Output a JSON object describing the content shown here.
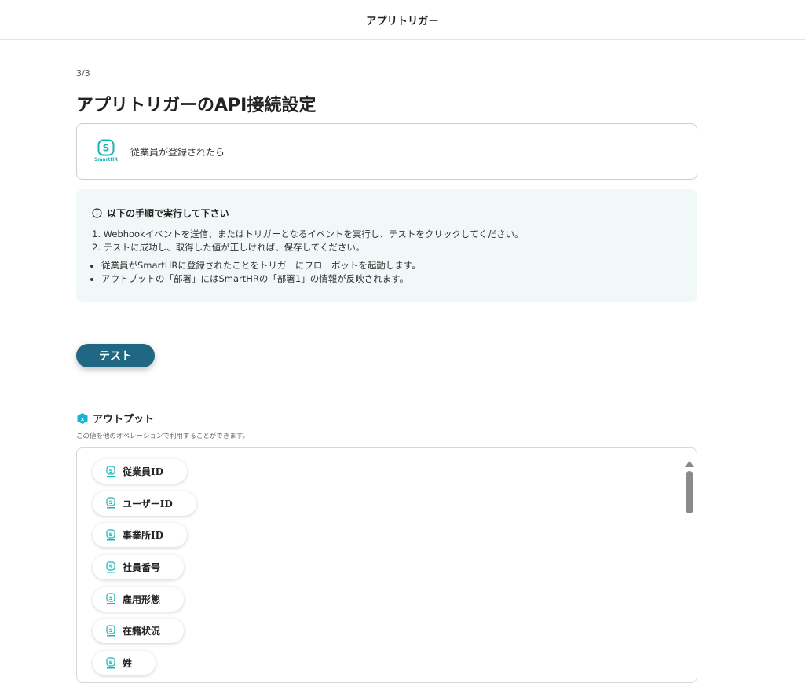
{
  "header": {
    "title": "アプリトリガー"
  },
  "step": "3/3",
  "page_title": "アプリトリガーのAPI接続設定",
  "app_card": {
    "logo_text": "SmartHR",
    "trigger": "従業員が登録されたら"
  },
  "info": {
    "heading": "以下の手順で実行して下さい",
    "steps": [
      "1. Webhookイベントを送信、またはトリガーとなるイベントを実行し、テストをクリックしてください。",
      "2. テストに成功し、取得した値が正しければ、保存してください。"
    ],
    "bullets": [
      "従業員がSmartHRに登録されたことをトリガーにフローボットを起動します。",
      "アウトプットの「部署」にはSmartHRの「部署1」の情報が反映されます。"
    ]
  },
  "test_button": "テスト",
  "output": {
    "title": "アウトプット",
    "note": "この値を他のオペレーションで利用することができます。",
    "items": [
      "従業員ID",
      "ユーザーID",
      "事業所ID",
      "社員番号",
      "雇用形態",
      "在籍状況",
      "姓"
    ]
  },
  "colors": {
    "accent": "#1f6783",
    "brand": "#17b5b5",
    "info_bg": "#f0f8f8"
  }
}
